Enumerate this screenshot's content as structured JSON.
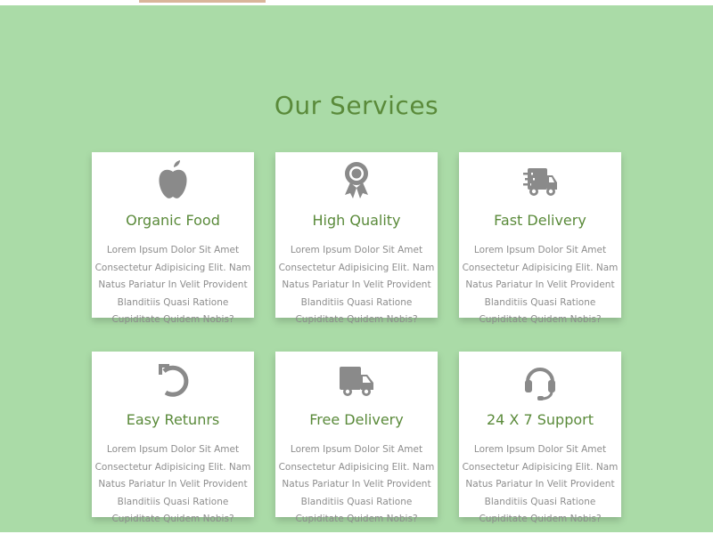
{
  "section": {
    "title": "Our Services"
  },
  "services": [
    {
      "title": "Organic Food",
      "icon": "apple-icon",
      "description": "Lorem Ipsum Dolor Sit Amet Consectetur Adipisicing Elit. Nam Natus Pariatur In Velit Provident Blanditiis Quasi Ratione Cupiditate Quidem Nobis?"
    },
    {
      "title": "High Quality",
      "icon": "award-ribbon-icon",
      "description": "Lorem Ipsum Dolor Sit Amet Consectetur Adipisicing Elit. Nam Natus Pariatur In Velit Provident Blanditiis Quasi Ratione Cupiditate Quidem Nobis?"
    },
    {
      "title": "Fast Delivery",
      "icon": "shipping-fast-truck-icon",
      "description": "Lorem Ipsum Dolor Sit Amet Consectetur Adipisicing Elit. Nam Natus Pariatur In Velit Provident Blanditiis Quasi Ratione Cupiditate Quidem Nobis?"
    },
    {
      "title": "Easy Retunrs",
      "icon": "undo-arrow-icon",
      "description": "Lorem Ipsum Dolor Sit Amet Consectetur Adipisicing Elit. Nam Natus Pariatur In Velit Provident Blanditiis Quasi Ratione Cupiditate Quidem Nobis?"
    },
    {
      "title": "Free Delivery",
      "icon": "delivery-truck-icon",
      "description": "Lorem Ipsum Dolor Sit Amet Consectetur Adipisicing Elit. Nam Natus Pariatur In Velit Provident Blanditiis Quasi Ratione Cupiditate Quidem Nobis?"
    },
    {
      "title": "24 X 7 Support",
      "icon": "headset-icon",
      "description": "Lorem Ipsum Dolor Sit Amet Consectetur Adipisicing Elit. Nam Natus Pariatur In Velit Provident Blanditiis Quasi Ratione Cupiditate Quidem Nobis?"
    }
  ],
  "colors": {
    "section_background": "#aadba7",
    "title_green": "#5a8a3a",
    "icon_gray": "#8a8a8a",
    "text_gray": "#8d8d8d",
    "card_background": "#ffffff"
  }
}
